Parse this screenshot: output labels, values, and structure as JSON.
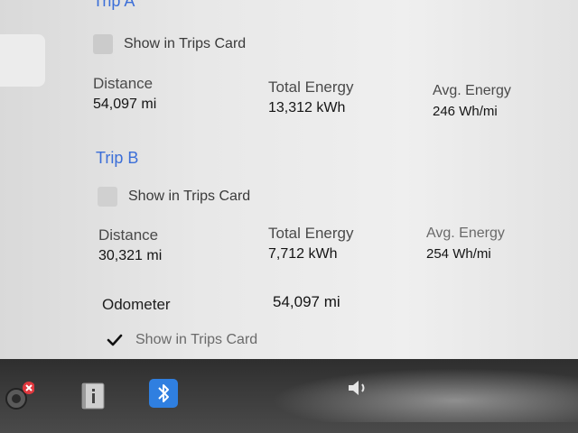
{
  "trip_a": {
    "title": "Trip A",
    "show_in_trips_card_label": "Show in Trips Card",
    "show_in_trips_card_checked": false,
    "distance_label": "Distance",
    "distance_value": "54,097 mi",
    "total_energy_label": "Total Energy",
    "total_energy_value": "13,312 kWh",
    "avg_energy_label": "Avg. Energy",
    "avg_energy_value": "246 Wh/mi"
  },
  "trip_b": {
    "title": "Trip B",
    "show_in_trips_card_label": "Show in Trips Card",
    "show_in_trips_card_checked": false,
    "distance_label": "Distance",
    "distance_value": "30,321 mi",
    "total_energy_label": "Total Energy",
    "total_energy_value": "7,712 kWh",
    "avg_energy_label": "Avg. Energy",
    "avg_energy_value": "254 Wh/mi"
  },
  "odometer": {
    "label": "Odometer",
    "value": "54,097 mi",
    "show_in_trips_card_label": "Show in Trips Card",
    "show_in_trips_card_checked": true
  },
  "taskbar": {
    "icons": [
      "camera-icon",
      "manual-icon",
      "bluetooth-icon",
      "volume-icon"
    ],
    "camera_badge_color": "#e0383e",
    "bluetooth_color": "#2f7fe0"
  },
  "colors": {
    "accent": "#3b6ed8"
  }
}
